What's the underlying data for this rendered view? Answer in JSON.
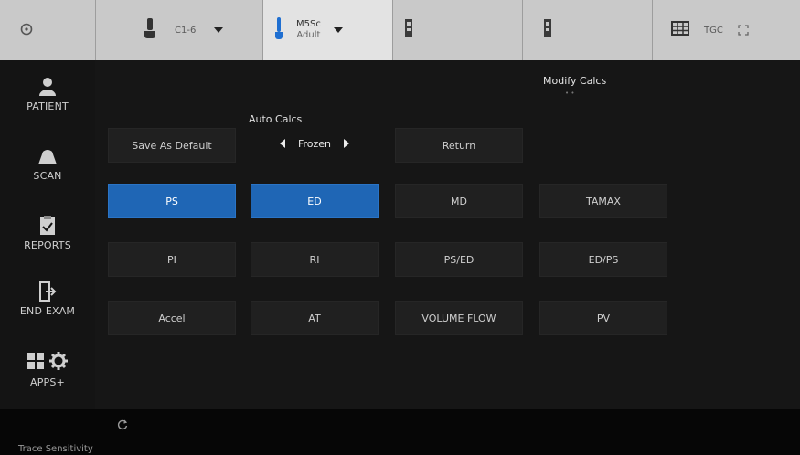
{
  "topbar": {
    "probe1": {
      "name": "C1-6"
    },
    "probe2": {
      "name": "M5Sc",
      "preset": "Adult"
    },
    "tgc_label": "TGC"
  },
  "sidebar": {
    "items": [
      {
        "label": "PATIENT",
        "icon": "patient-icon"
      },
      {
        "label": "SCAN",
        "icon": "scan-icon"
      },
      {
        "label": "REPORTS",
        "icon": "reports-icon"
      },
      {
        "label": "END EXAM",
        "icon": "end-exam-icon"
      },
      {
        "label": "APPS+",
        "icon": "apps-icon"
      }
    ]
  },
  "main": {
    "title": "Modify Calcs",
    "auto_calcs": {
      "label": "Auto Calcs",
      "value": "Frozen"
    },
    "buttons": {
      "save_default": "Save As Default",
      "return": "Return"
    },
    "calcs": [
      {
        "label": "PS",
        "selected": true
      },
      {
        "label": "ED",
        "selected": true
      },
      {
        "label": "MD",
        "selected": false
      },
      {
        "label": "TAMAX",
        "selected": false
      },
      {
        "label": "PI",
        "selected": false
      },
      {
        "label": "RI",
        "selected": false
      },
      {
        "label": "PS/ED",
        "selected": false
      },
      {
        "label": "ED/PS",
        "selected": false
      },
      {
        "label": "Accel",
        "selected": false
      },
      {
        "label": "AT",
        "selected": false
      },
      {
        "label": "VOLUME FLOW",
        "selected": false
      },
      {
        "label": "PV",
        "selected": false
      }
    ]
  },
  "bottom": {
    "label": "Trace Sensitivity"
  },
  "colors": {
    "accent": "#1f66b5",
    "topbar": "#c9c9c9",
    "background": "#161616"
  }
}
